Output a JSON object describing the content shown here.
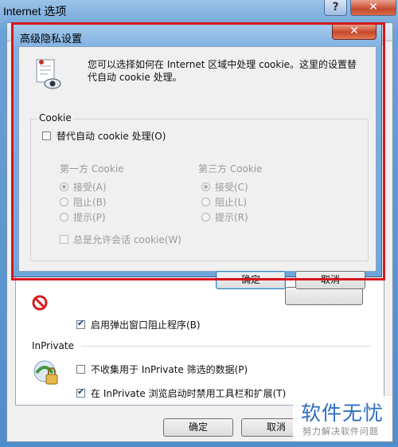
{
  "outer_window": {
    "title": "Internet 选项",
    "help_glyph": "?",
    "close_glyph": "✕",
    "popup_blocker_label": "启用弹出窗口阻止程序(B)",
    "popup_blocker_checked": true,
    "inprivate_group_label": "InPrivate",
    "inprivate_no_collect_label": "不收集用于 InPrivate 筛选的数据(P)",
    "inprivate_no_collect_checked": false,
    "inprivate_disable_toolbars_label": "在 InPrivate 浏览启动时禁用工具栏和扩展(T)",
    "inprivate_disable_toolbars_checked": true,
    "ok_button": "确定",
    "cancel_button": "取消"
  },
  "dialog": {
    "title": "高级隐私设置",
    "close_glyph": "✕",
    "description": "您可以选择如何在 Internet 区域中处理 cookie。这里的设置替代自动 cookie 处理。",
    "cookie_group_label": "Cookie",
    "override_label": "替代自动 cookie 处理(O)",
    "override_checked": false,
    "first_party": {
      "heading": "第一方 Cookie",
      "options": [
        "接受(A)",
        "阻止(B)",
        "提示(P)"
      ],
      "selected": "接受(A)"
    },
    "third_party": {
      "heading": "第三方 Cookie",
      "options": [
        "接受(C)",
        "阻止(L)",
        "提示(R)"
      ],
      "selected": "接受(C)"
    },
    "session_cookie_label": "总是允许会话 cookie(W)",
    "session_cookie_checked": false,
    "ok_button": "确定",
    "cancel_button": "取消"
  },
  "watermark": {
    "title": "软件无忧",
    "subtitle": "努力解决软件问题"
  },
  "colors": {
    "highlight_border": "#d6161d",
    "title_bar": "#7fb0e1",
    "watermark_text": "#2f6fc0"
  }
}
